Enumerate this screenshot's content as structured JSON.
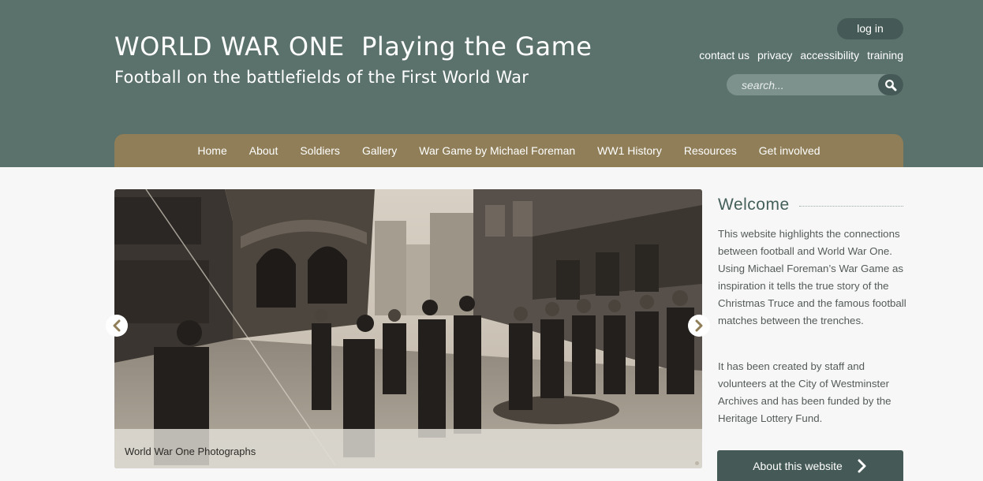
{
  "header": {
    "title": "WORLD WAR ONE  Playing the Game",
    "subtitle": "Football on the battlefields of the First World War",
    "login_label": "log in",
    "util_links": [
      "contact us",
      "privacy",
      "accessibility",
      "training"
    ],
    "search_placeholder": "search..."
  },
  "nav": {
    "items": [
      "Home",
      "About",
      "Soldiers",
      "Gallery",
      "War Game by Michael Foreman",
      "WW1 History",
      "Resources",
      "Get involved"
    ]
  },
  "slider": {
    "caption": "World War One Photographs"
  },
  "welcome": {
    "title": "Welcome",
    "paragraphs": [
      "This website highlights the connections between football and World War One. Using Michael Foreman’s War Game as inspiration it tells the true story of the Christmas Truce and the famous football matches between the trenches.",
      "It has been created by staff and volunteers at the City of Westminster Archives and has been funded by the Heritage Lottery Fund."
    ],
    "button_label": "About this website"
  },
  "colors": {
    "header_bg": "#5a716c",
    "nav_bg": "#8f7e57",
    "dark_accent": "#455a56"
  },
  "icons": [
    "search-icon",
    "chevron-left-icon",
    "chevron-right-icon"
  ]
}
